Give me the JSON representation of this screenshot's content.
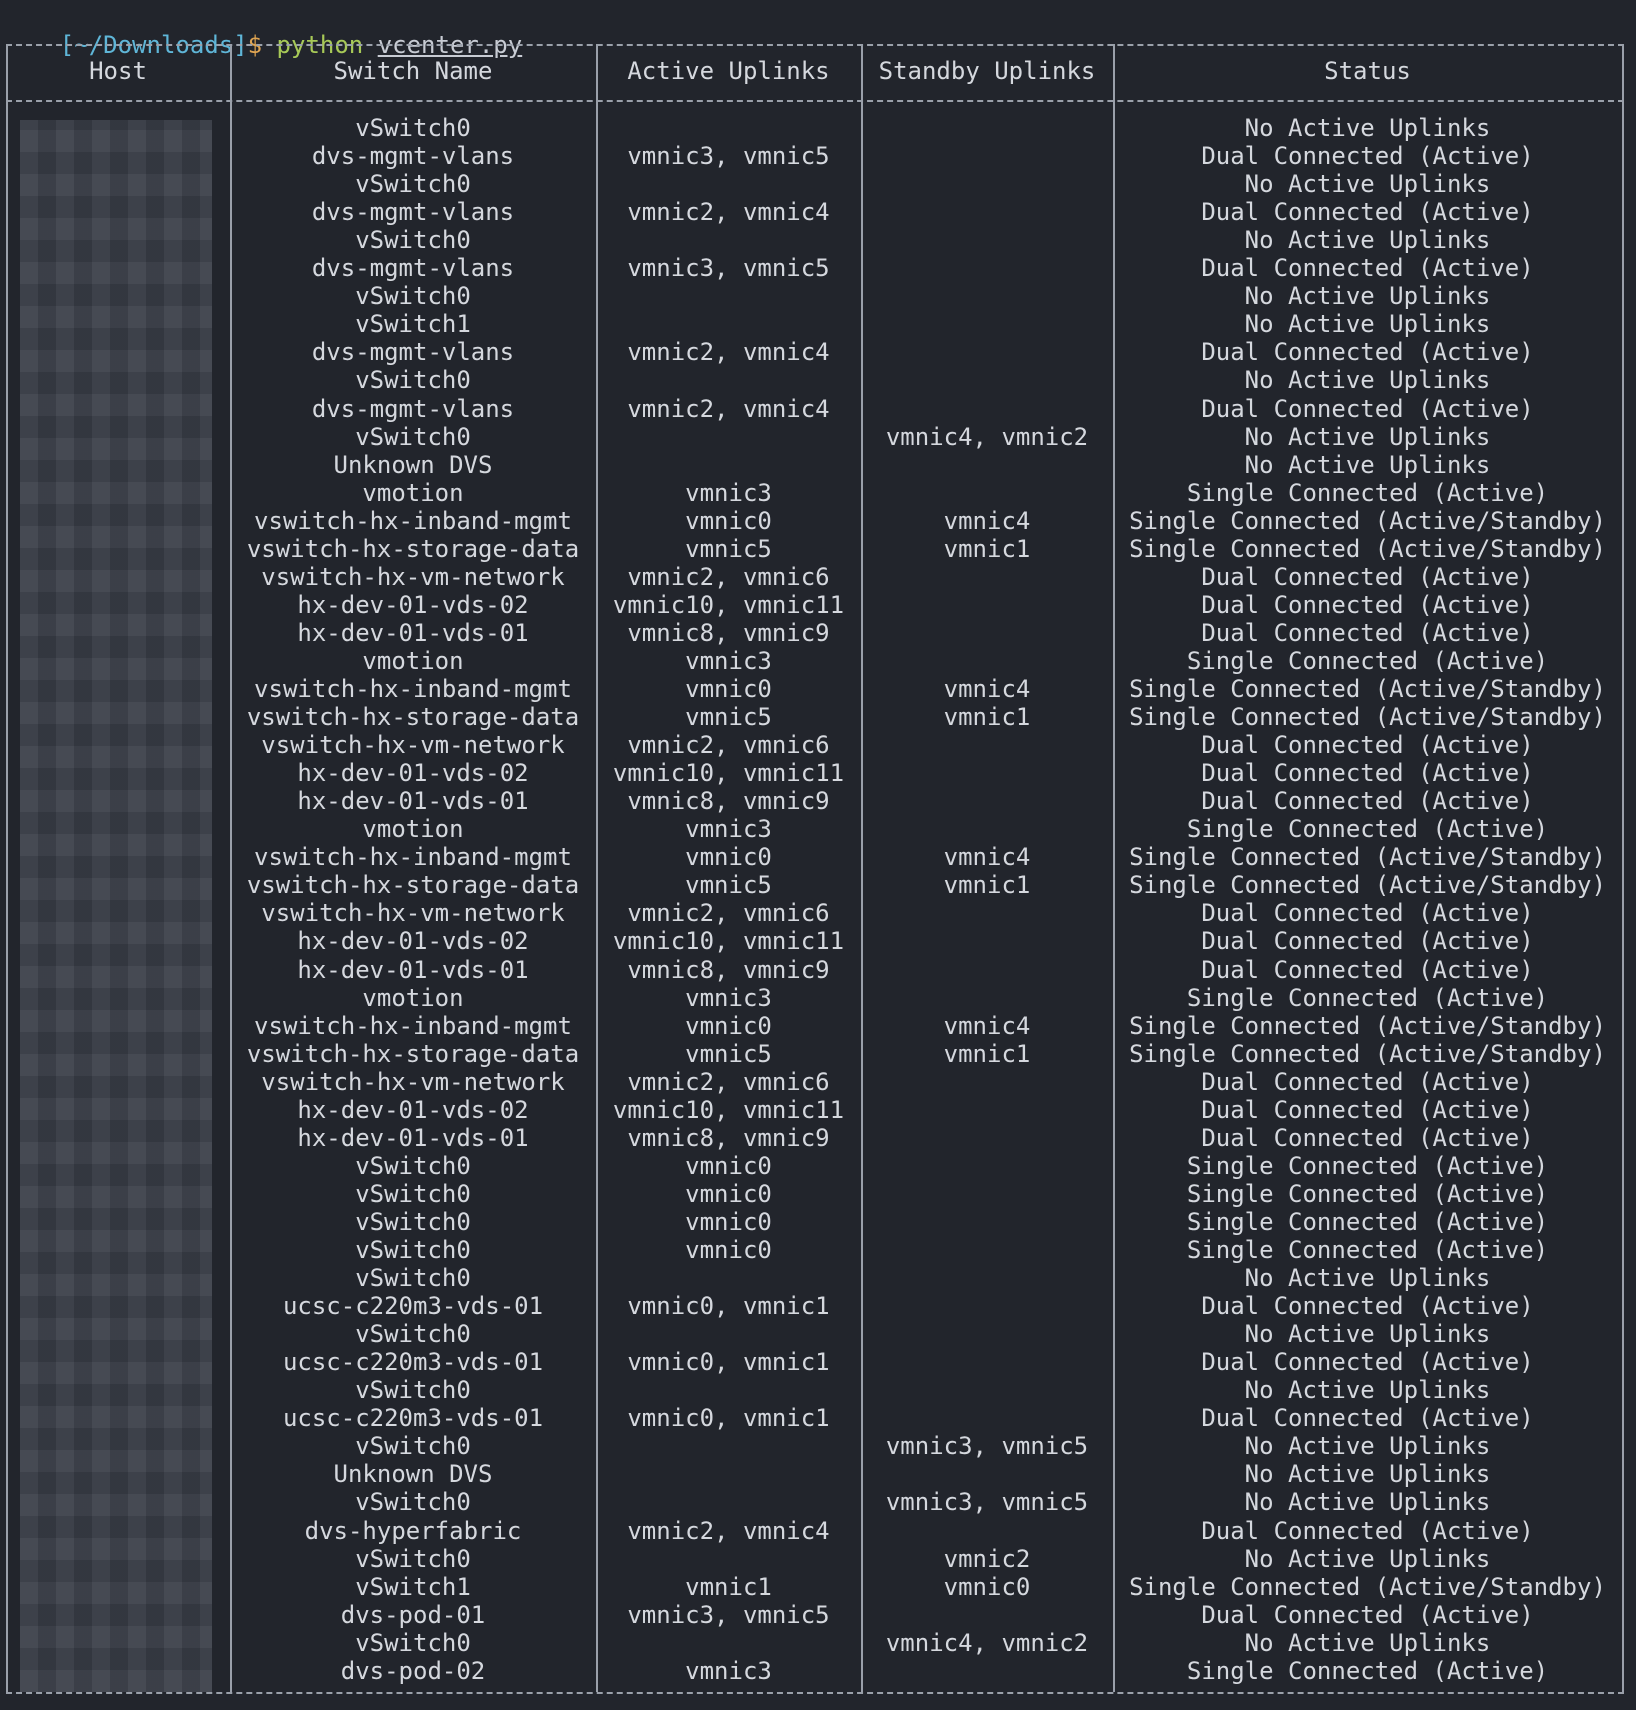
{
  "prompt": {
    "path": "[~/Downloads]",
    "dollar": "$",
    "command": "python",
    "argument": "vcenter.py"
  },
  "table": {
    "headers": [
      "Host",
      "Switch Name",
      "Active Uplinks",
      "Standby Uplinks",
      "Status"
    ],
    "rows": [
      [
        "",
        "vSwitch0",
        "",
        "",
        "No Active Uplinks"
      ],
      [
        "",
        "dvs-mgmt-vlans",
        "vmnic3, vmnic5",
        "",
        "Dual Connected (Active)"
      ],
      [
        "",
        "vSwitch0",
        "",
        "",
        "No Active Uplinks"
      ],
      [
        "",
        "dvs-mgmt-vlans",
        "vmnic2, vmnic4",
        "",
        "Dual Connected (Active)"
      ],
      [
        "",
        "vSwitch0",
        "",
        "",
        "No Active Uplinks"
      ],
      [
        "",
        "dvs-mgmt-vlans",
        "vmnic3, vmnic5",
        "",
        "Dual Connected (Active)"
      ],
      [
        "",
        "vSwitch0",
        "",
        "",
        "No Active Uplinks"
      ],
      [
        "",
        "vSwitch1",
        "",
        "",
        "No Active Uplinks"
      ],
      [
        "",
        "dvs-mgmt-vlans",
        "vmnic2, vmnic4",
        "",
        "Dual Connected (Active)"
      ],
      [
        "",
        "vSwitch0",
        "",
        "",
        "No Active Uplinks"
      ],
      [
        "",
        "dvs-mgmt-vlans",
        "vmnic2, vmnic4",
        "",
        "Dual Connected (Active)"
      ],
      [
        "",
        "vSwitch0",
        "",
        "vmnic4, vmnic2",
        "No Active Uplinks"
      ],
      [
        "",
        "Unknown DVS",
        "",
        "",
        "No Active Uplinks"
      ],
      [
        "",
        "vmotion",
        "vmnic3",
        "",
        "Single Connected (Active)"
      ],
      [
        "",
        "vswitch-hx-inband-mgmt",
        "vmnic0",
        "vmnic4",
        "Single Connected (Active/Standby)"
      ],
      [
        "",
        "vswitch-hx-storage-data",
        "vmnic5",
        "vmnic1",
        "Single Connected (Active/Standby)"
      ],
      [
        "",
        "vswitch-hx-vm-network",
        "vmnic2, vmnic6",
        "",
        "Dual Connected (Active)"
      ],
      [
        "",
        "hx-dev-01-vds-02",
        "vmnic10, vmnic11",
        "",
        "Dual Connected (Active)"
      ],
      [
        "",
        "hx-dev-01-vds-01",
        "vmnic8, vmnic9",
        "",
        "Dual Connected (Active)"
      ],
      [
        "",
        "vmotion",
        "vmnic3",
        "",
        "Single Connected (Active)"
      ],
      [
        "",
        "vswitch-hx-inband-mgmt",
        "vmnic0",
        "vmnic4",
        "Single Connected (Active/Standby)"
      ],
      [
        "",
        "vswitch-hx-storage-data",
        "vmnic5",
        "vmnic1",
        "Single Connected (Active/Standby)"
      ],
      [
        "",
        "vswitch-hx-vm-network",
        "vmnic2, vmnic6",
        "",
        "Dual Connected (Active)"
      ],
      [
        "",
        "hx-dev-01-vds-02",
        "vmnic10, vmnic11",
        "",
        "Dual Connected (Active)"
      ],
      [
        "",
        "hx-dev-01-vds-01",
        "vmnic8, vmnic9",
        "",
        "Dual Connected (Active)"
      ],
      [
        "",
        "vmotion",
        "vmnic3",
        "",
        "Single Connected (Active)"
      ],
      [
        "",
        "vswitch-hx-inband-mgmt",
        "vmnic0",
        "vmnic4",
        "Single Connected (Active/Standby)"
      ],
      [
        "",
        "vswitch-hx-storage-data",
        "vmnic5",
        "vmnic1",
        "Single Connected (Active/Standby)"
      ],
      [
        "",
        "vswitch-hx-vm-network",
        "vmnic2, vmnic6",
        "",
        "Dual Connected (Active)"
      ],
      [
        "",
        "hx-dev-01-vds-02",
        "vmnic10, vmnic11",
        "",
        "Dual Connected (Active)"
      ],
      [
        "",
        "hx-dev-01-vds-01",
        "vmnic8, vmnic9",
        "",
        "Dual Connected (Active)"
      ],
      [
        "",
        "vmotion",
        "vmnic3",
        "",
        "Single Connected (Active)"
      ],
      [
        "",
        "vswitch-hx-inband-mgmt",
        "vmnic0",
        "vmnic4",
        "Single Connected (Active/Standby)"
      ],
      [
        "",
        "vswitch-hx-storage-data",
        "vmnic5",
        "vmnic1",
        "Single Connected (Active/Standby)"
      ],
      [
        "",
        "vswitch-hx-vm-network",
        "vmnic2, vmnic6",
        "",
        "Dual Connected (Active)"
      ],
      [
        "",
        "hx-dev-01-vds-02",
        "vmnic10, vmnic11",
        "",
        "Dual Connected (Active)"
      ],
      [
        "",
        "hx-dev-01-vds-01",
        "vmnic8, vmnic9",
        "",
        "Dual Connected (Active)"
      ],
      [
        "",
        "vSwitch0",
        "vmnic0",
        "",
        "Single Connected (Active)"
      ],
      [
        "",
        "vSwitch0",
        "vmnic0",
        "",
        "Single Connected (Active)"
      ],
      [
        "",
        "vSwitch0",
        "vmnic0",
        "",
        "Single Connected (Active)"
      ],
      [
        "",
        "vSwitch0",
        "vmnic0",
        "",
        "Single Connected (Active)"
      ],
      [
        "",
        "vSwitch0",
        "",
        "",
        "No Active Uplinks"
      ],
      [
        "",
        "ucsc-c220m3-vds-01",
        "vmnic0, vmnic1",
        "",
        "Dual Connected (Active)"
      ],
      [
        "",
        "vSwitch0",
        "",
        "",
        "No Active Uplinks"
      ],
      [
        "",
        "ucsc-c220m3-vds-01",
        "vmnic0, vmnic1",
        "",
        "Dual Connected (Active)"
      ],
      [
        "",
        "vSwitch0",
        "",
        "",
        "No Active Uplinks"
      ],
      [
        "",
        "ucsc-c220m3-vds-01",
        "vmnic0, vmnic1",
        "",
        "Dual Connected (Active)"
      ],
      [
        "",
        "vSwitch0",
        "",
        "vmnic3, vmnic5",
        "No Active Uplinks"
      ],
      [
        "",
        "Unknown DVS",
        "",
        "",
        "No Active Uplinks"
      ],
      [
        "",
        "vSwitch0",
        "",
        "vmnic3, vmnic5",
        "No Active Uplinks"
      ],
      [
        "",
        "dvs-hyperfabric",
        "vmnic2, vmnic4",
        "",
        "Dual Connected (Active)"
      ],
      [
        "",
        "vSwitch0",
        "",
        "vmnic2",
        "No Active Uplinks"
      ],
      [
        "",
        "vSwitch1",
        "vmnic1",
        "vmnic0",
        "Single Connected (Active/Standby)"
      ],
      [
        "",
        "dvs-pod-01",
        "vmnic3, vmnic5",
        "",
        "Dual Connected (Active)"
      ],
      [
        "",
        "vSwitch0",
        "",
        "vmnic4, vmnic2",
        "No Active Uplinks"
      ],
      [
        "",
        "dvs-pod-02",
        "vmnic3",
        "",
        "Single Connected (Active)"
      ]
    ]
  }
}
